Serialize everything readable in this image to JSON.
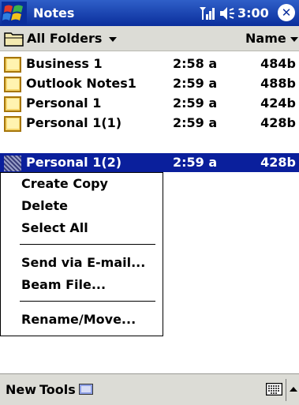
{
  "title_bar": {
    "app_name": "Notes",
    "time": "3:00",
    "close_glyph": "✕",
    "icons": [
      "windows-flag-icon",
      "signal-icon",
      "volume-icon",
      "close-icon"
    ]
  },
  "folder_bar": {
    "folder_label": "All Folders",
    "sort_label": "Name"
  },
  "files": [
    {
      "name": "Business 1",
      "time": "2:58 a",
      "size": "484b"
    },
    {
      "name": "Outlook Notes1",
      "time": "2:59 a",
      "size": "488b"
    },
    {
      "name": "Personal 1",
      "time": "2:59 a",
      "size": "424b"
    },
    {
      "name": "Personal 1(1)",
      "time": "2:59 a",
      "size": "428b"
    },
    {
      "name": "Personal 1(2)",
      "time": "2:59 a",
      "size": "428b",
      "selected": true
    }
  ],
  "context_menu": {
    "items": [
      "Create Copy",
      "Delete",
      "Select All",
      "Send via E-mail...",
      "Beam File...",
      "Rename/Move..."
    ]
  },
  "bottom_bar": {
    "new_label": "New",
    "tools_label": "Tools"
  },
  "colors": {
    "title_bar": "#0a2e9c",
    "selection": "#0a1f9c",
    "bar_gray": "#dcdcd6"
  }
}
